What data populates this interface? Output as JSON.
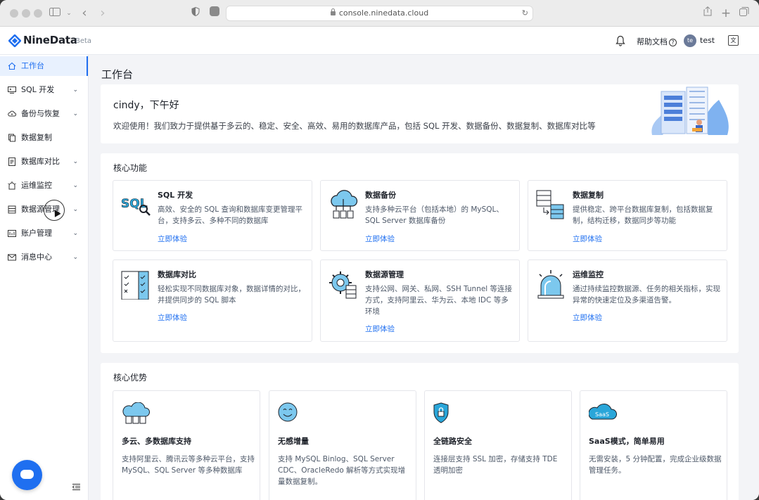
{
  "browser": {
    "url": "console.ninedata.cloud"
  },
  "header": {
    "logo_text": "NineData",
    "logo_badge": "Beta",
    "help_label": "帮助文档",
    "user_name": "test",
    "avatar_initial": "te"
  },
  "sidebar": {
    "items": [
      {
        "label": "工作台",
        "icon": "home-icon",
        "active": true
      },
      {
        "label": "SQL 开发",
        "icon": "terminal-icon"
      },
      {
        "label": "备份与恢复",
        "icon": "cloud-backup-icon"
      },
      {
        "label": "数据复制",
        "icon": "copy-icon"
      },
      {
        "label": "数据库对比",
        "icon": "compare-icon"
      },
      {
        "label": "运维监控",
        "icon": "monitor-icon"
      },
      {
        "label": "数据源管理",
        "icon": "datasource-icon"
      },
      {
        "label": "账户管理",
        "icon": "account-icon"
      },
      {
        "label": "消息中心",
        "icon": "mail-icon"
      }
    ]
  },
  "main": {
    "page_title": "工作台",
    "welcome": {
      "greeting": "cindy，下午好",
      "text": "欢迎使用！我们致力于提供基于多云的、稳定、安全、高效、易用的数据库产品，包括 SQL 开发、数据备份、数据复制、数据库对比等"
    },
    "core_features": {
      "title": "核心功能",
      "items": [
        {
          "title": "SQL 开发",
          "desc": "高效、安全的 SQL 查询和数据库变更管理平台，支持多云、多种不同的数据库",
          "link": "立即体验",
          "icon": "sql-icon"
        },
        {
          "title": "数据备份",
          "desc": "支持多种云平台（包括本地）的 MySQL、SQL Server 数据库备份",
          "link": "立即体验",
          "icon": "cloud-backup-icon"
        },
        {
          "title": "数据复制",
          "desc": "提供稳定、跨平台数据库复制，包括数据复制，结构迁移，数据同步等功能",
          "link": "立即体验",
          "icon": "replication-icon"
        },
        {
          "title": "数据库对比",
          "desc": "轻松实现不同数据库对象，数据详情的对比，并提供同步的 SQL 脚本",
          "link": "立即体验",
          "icon": "checklist-icon"
        },
        {
          "title": "数据源管理",
          "desc": "支持公网、网关、私网、SSH Tunnel 等连接方式，支持阿里云、华为云、本地 IDC 等多环境",
          "link": "立即体验",
          "icon": "gear-datasource-icon"
        },
        {
          "title": "运维监控",
          "desc": "通过持续监控数据源、任务的相关指标，实现异常的快速定位及多渠道告警。",
          "link": "立即体验",
          "icon": "alarm-icon"
        }
      ]
    },
    "core_advantages": {
      "title": "核心优势",
      "items": [
        {
          "title": "多云、多数据库支持",
          "desc": "支持阿里云、腾讯云等多种云平台，支持 MySQL、SQL Server 等多种数据库",
          "icon": "multi-cloud-icon"
        },
        {
          "title": "无感增量",
          "desc": "支持 MySQL Binlog、SQL Server CDC、OracleRedo 解析等方式实现增量数据复制。",
          "icon": "smile-icon"
        },
        {
          "title": "全链路安全",
          "desc": "连接层支持 SSL 加密，存储支持 TDE 透明加密",
          "icon": "shield-lock-icon"
        },
        {
          "title": "SaaS模式，简单易用",
          "desc": "无需安装，5 分钟配置，完成企业级数据管理任务。",
          "icon": "saas-cloud-icon",
          "icon_text": "SaaS"
        }
      ]
    }
  },
  "colors": {
    "primary": "#1f6ff0",
    "sidebar_active_bg": "#e8f1fe",
    "page_bg": "#f3f4f7",
    "icon_cyan": "#2aa6d9"
  }
}
